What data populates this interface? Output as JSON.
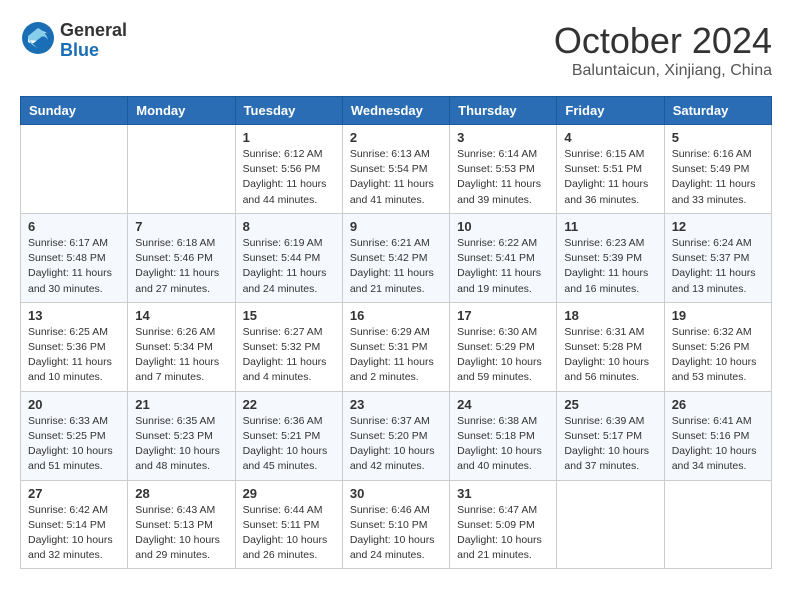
{
  "header": {
    "logo_general": "General",
    "logo_blue": "Blue",
    "month_title": "October 2024",
    "location": "Baluntaicun, Xinjiang, China"
  },
  "days_of_week": [
    "Sunday",
    "Monday",
    "Tuesday",
    "Wednesday",
    "Thursday",
    "Friday",
    "Saturday"
  ],
  "weeks": [
    [
      {
        "day": "",
        "info": ""
      },
      {
        "day": "",
        "info": ""
      },
      {
        "day": "1",
        "info": "Sunrise: 6:12 AM\nSunset: 5:56 PM\nDaylight: 11 hours and 44 minutes."
      },
      {
        "day": "2",
        "info": "Sunrise: 6:13 AM\nSunset: 5:54 PM\nDaylight: 11 hours and 41 minutes."
      },
      {
        "day": "3",
        "info": "Sunrise: 6:14 AM\nSunset: 5:53 PM\nDaylight: 11 hours and 39 minutes."
      },
      {
        "day": "4",
        "info": "Sunrise: 6:15 AM\nSunset: 5:51 PM\nDaylight: 11 hours and 36 minutes."
      },
      {
        "day": "5",
        "info": "Sunrise: 6:16 AM\nSunset: 5:49 PM\nDaylight: 11 hours and 33 minutes."
      }
    ],
    [
      {
        "day": "6",
        "info": "Sunrise: 6:17 AM\nSunset: 5:48 PM\nDaylight: 11 hours and 30 minutes."
      },
      {
        "day": "7",
        "info": "Sunrise: 6:18 AM\nSunset: 5:46 PM\nDaylight: 11 hours and 27 minutes."
      },
      {
        "day": "8",
        "info": "Sunrise: 6:19 AM\nSunset: 5:44 PM\nDaylight: 11 hours and 24 minutes."
      },
      {
        "day": "9",
        "info": "Sunrise: 6:21 AM\nSunset: 5:42 PM\nDaylight: 11 hours and 21 minutes."
      },
      {
        "day": "10",
        "info": "Sunrise: 6:22 AM\nSunset: 5:41 PM\nDaylight: 11 hours and 19 minutes."
      },
      {
        "day": "11",
        "info": "Sunrise: 6:23 AM\nSunset: 5:39 PM\nDaylight: 11 hours and 16 minutes."
      },
      {
        "day": "12",
        "info": "Sunrise: 6:24 AM\nSunset: 5:37 PM\nDaylight: 11 hours and 13 minutes."
      }
    ],
    [
      {
        "day": "13",
        "info": "Sunrise: 6:25 AM\nSunset: 5:36 PM\nDaylight: 11 hours and 10 minutes."
      },
      {
        "day": "14",
        "info": "Sunrise: 6:26 AM\nSunset: 5:34 PM\nDaylight: 11 hours and 7 minutes."
      },
      {
        "day": "15",
        "info": "Sunrise: 6:27 AM\nSunset: 5:32 PM\nDaylight: 11 hours and 4 minutes."
      },
      {
        "day": "16",
        "info": "Sunrise: 6:29 AM\nSunset: 5:31 PM\nDaylight: 11 hours and 2 minutes."
      },
      {
        "day": "17",
        "info": "Sunrise: 6:30 AM\nSunset: 5:29 PM\nDaylight: 10 hours and 59 minutes."
      },
      {
        "day": "18",
        "info": "Sunrise: 6:31 AM\nSunset: 5:28 PM\nDaylight: 10 hours and 56 minutes."
      },
      {
        "day": "19",
        "info": "Sunrise: 6:32 AM\nSunset: 5:26 PM\nDaylight: 10 hours and 53 minutes."
      }
    ],
    [
      {
        "day": "20",
        "info": "Sunrise: 6:33 AM\nSunset: 5:25 PM\nDaylight: 10 hours and 51 minutes."
      },
      {
        "day": "21",
        "info": "Sunrise: 6:35 AM\nSunset: 5:23 PM\nDaylight: 10 hours and 48 minutes."
      },
      {
        "day": "22",
        "info": "Sunrise: 6:36 AM\nSunset: 5:21 PM\nDaylight: 10 hours and 45 minutes."
      },
      {
        "day": "23",
        "info": "Sunrise: 6:37 AM\nSunset: 5:20 PM\nDaylight: 10 hours and 42 minutes."
      },
      {
        "day": "24",
        "info": "Sunrise: 6:38 AM\nSunset: 5:18 PM\nDaylight: 10 hours and 40 minutes."
      },
      {
        "day": "25",
        "info": "Sunrise: 6:39 AM\nSunset: 5:17 PM\nDaylight: 10 hours and 37 minutes."
      },
      {
        "day": "26",
        "info": "Sunrise: 6:41 AM\nSunset: 5:16 PM\nDaylight: 10 hours and 34 minutes."
      }
    ],
    [
      {
        "day": "27",
        "info": "Sunrise: 6:42 AM\nSunset: 5:14 PM\nDaylight: 10 hours and 32 minutes."
      },
      {
        "day": "28",
        "info": "Sunrise: 6:43 AM\nSunset: 5:13 PM\nDaylight: 10 hours and 29 minutes."
      },
      {
        "day": "29",
        "info": "Sunrise: 6:44 AM\nSunset: 5:11 PM\nDaylight: 10 hours and 26 minutes."
      },
      {
        "day": "30",
        "info": "Sunrise: 6:46 AM\nSunset: 5:10 PM\nDaylight: 10 hours and 24 minutes."
      },
      {
        "day": "31",
        "info": "Sunrise: 6:47 AM\nSunset: 5:09 PM\nDaylight: 10 hours and 21 minutes."
      },
      {
        "day": "",
        "info": ""
      },
      {
        "day": "",
        "info": ""
      }
    ]
  ]
}
